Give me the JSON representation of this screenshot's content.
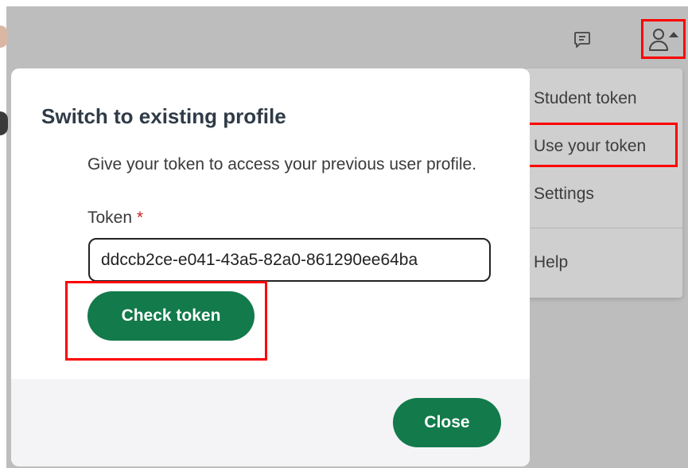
{
  "header": {
    "feedback_icon": "feedback-icon",
    "account_icon": "account-icon"
  },
  "account_menu": {
    "items": [
      {
        "label": "Student token"
      },
      {
        "label": "Use your token"
      },
      {
        "label": "Settings"
      },
      {
        "label": "Help"
      }
    ]
  },
  "dialog": {
    "title": "Switch to existing profile",
    "description": "Give your token to access your previous user profile.",
    "token_label": "Token",
    "required_mark": "*",
    "token_value": "ddccb2ce-e041-43a5-82a0-861290ee64ba",
    "check_button": "Check token",
    "close_button": "Close"
  },
  "colors": {
    "primary_button": "#137a4b",
    "highlight_outline": "#ff0000",
    "required": "#c62828",
    "overlay": "#bdbdbd"
  }
}
